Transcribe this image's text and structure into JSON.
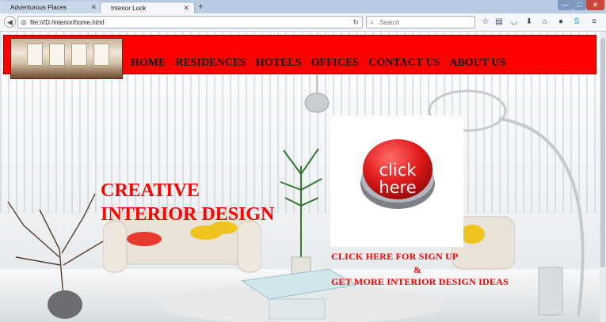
{
  "browser": {
    "tabs": [
      {
        "title": "Adventurous Places",
        "active": false
      },
      {
        "title": "Interior Look",
        "active": true
      }
    ],
    "new_tab_symbol": "+",
    "url": "file:///D:/interior/home.html",
    "search_placeholder": "Search",
    "window_buttons": {
      "minimize": "—",
      "maximize": "□",
      "close": "✕"
    },
    "toolbar_icons": [
      "star-icon",
      "clipboard-icon",
      "pocket-icon",
      "download-icon",
      "home-icon",
      "chat-icon",
      "skype-icon",
      "menu-icon"
    ]
  },
  "site": {
    "nav": [
      {
        "label": "HOME"
      },
      {
        "label": "RESIDENCES"
      },
      {
        "label": "HOTELS"
      },
      {
        "label": "OFFICES"
      },
      {
        "label": "CONTACT US"
      },
      {
        "label": "ABOUT US"
      }
    ],
    "headline_line1": "CREATIVE",
    "headline_line2": "INTERIOR DESIGN",
    "click_button_line1": "click",
    "click_button_line2": "here",
    "promo_line1": "CLICK HERE FOR SIGN UP",
    "promo_amp": "&",
    "promo_line2": "GET MORE INTERIOR DESIGN IDEAS"
  },
  "colors": {
    "header_bg": "#ff0000",
    "headline": "#ff0000",
    "promo": "#ff0000",
    "nav_text": "#111111"
  }
}
